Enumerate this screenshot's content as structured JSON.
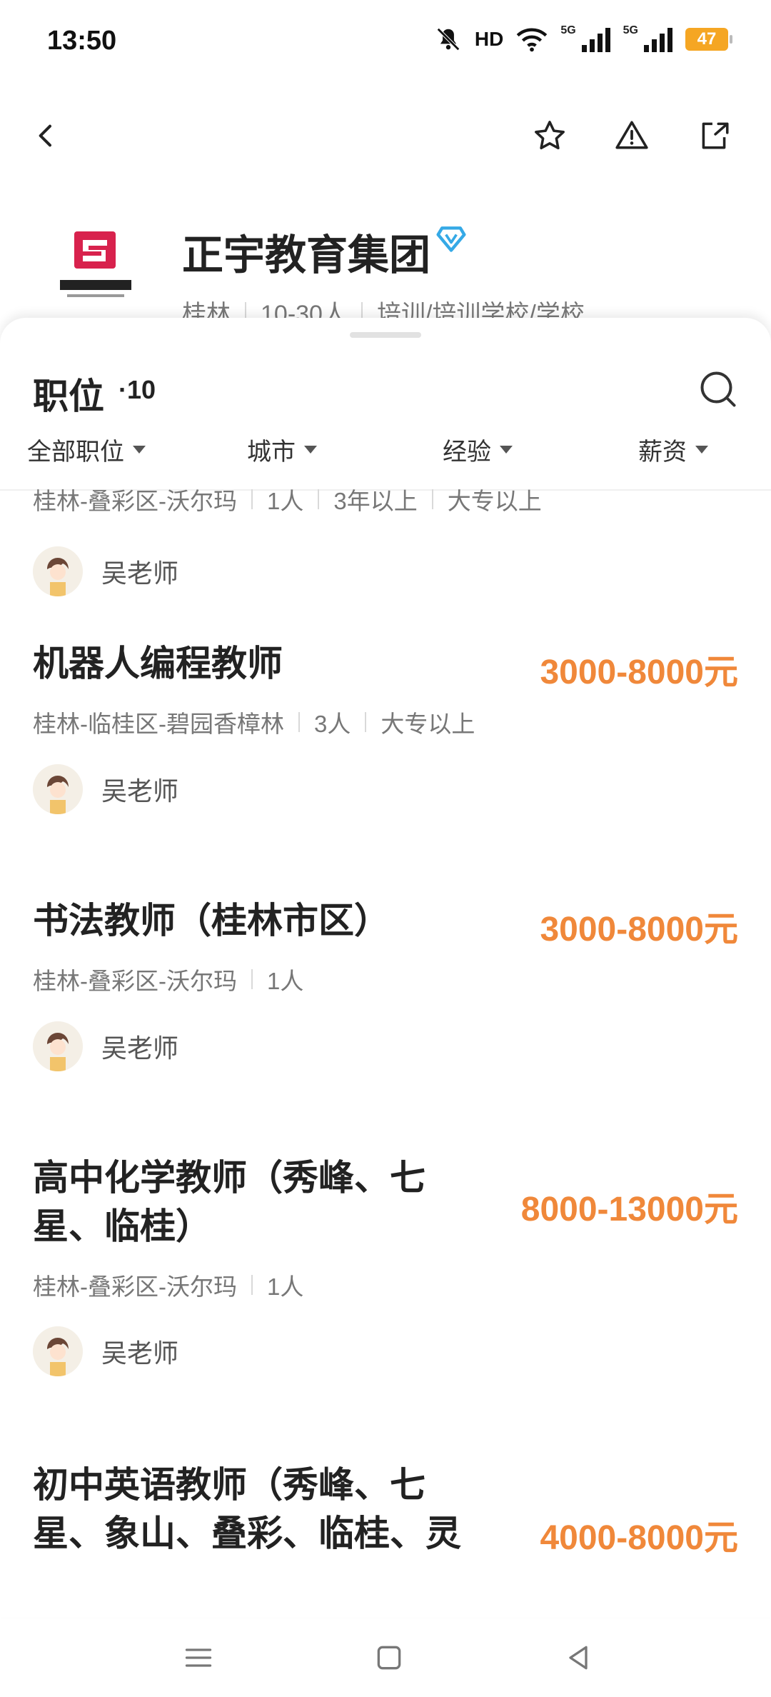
{
  "status_bar": {
    "time": "13:50",
    "hd_label": "HD",
    "network_1": "5G",
    "network_2": "5G",
    "battery": "47"
  },
  "company": {
    "name": "正宇教育集团",
    "city": "桂林",
    "size": "10-30人",
    "industry": "培训/培训学校/学校"
  },
  "positions": {
    "title": "职位",
    "count": "·10",
    "filters": [
      "全部职位",
      "城市",
      "经验",
      "薪资"
    ]
  },
  "jobs": [
    {
      "title": "",
      "salary": "",
      "meta": [
        "桂林-叠彩区-沃尔玛",
        "1人",
        "3年以上",
        "大专以上"
      ],
      "recruiter": "吴老师"
    },
    {
      "title": "机器人编程教师",
      "salary": "3000-8000元",
      "meta": [
        "桂林-临桂区-碧园香樟林",
        "3人",
        "大专以上"
      ],
      "recruiter": "吴老师"
    },
    {
      "title": "书法教师（桂林市区）",
      "salary": "3000-8000元",
      "meta": [
        "桂林-叠彩区-沃尔玛",
        "1人"
      ],
      "recruiter": "吴老师"
    },
    {
      "title": "高中化学教师（秀峰、七星、临桂）",
      "salary": "8000-13000元",
      "meta": [
        "桂林-叠彩区-沃尔玛",
        "1人"
      ],
      "recruiter": "吴老师"
    },
    {
      "title": "初中英语教师（秀峰、七星、象山、叠彩、临桂、灵",
      "salary": "4000-8000元",
      "meta": [],
      "recruiter": ""
    }
  ]
}
